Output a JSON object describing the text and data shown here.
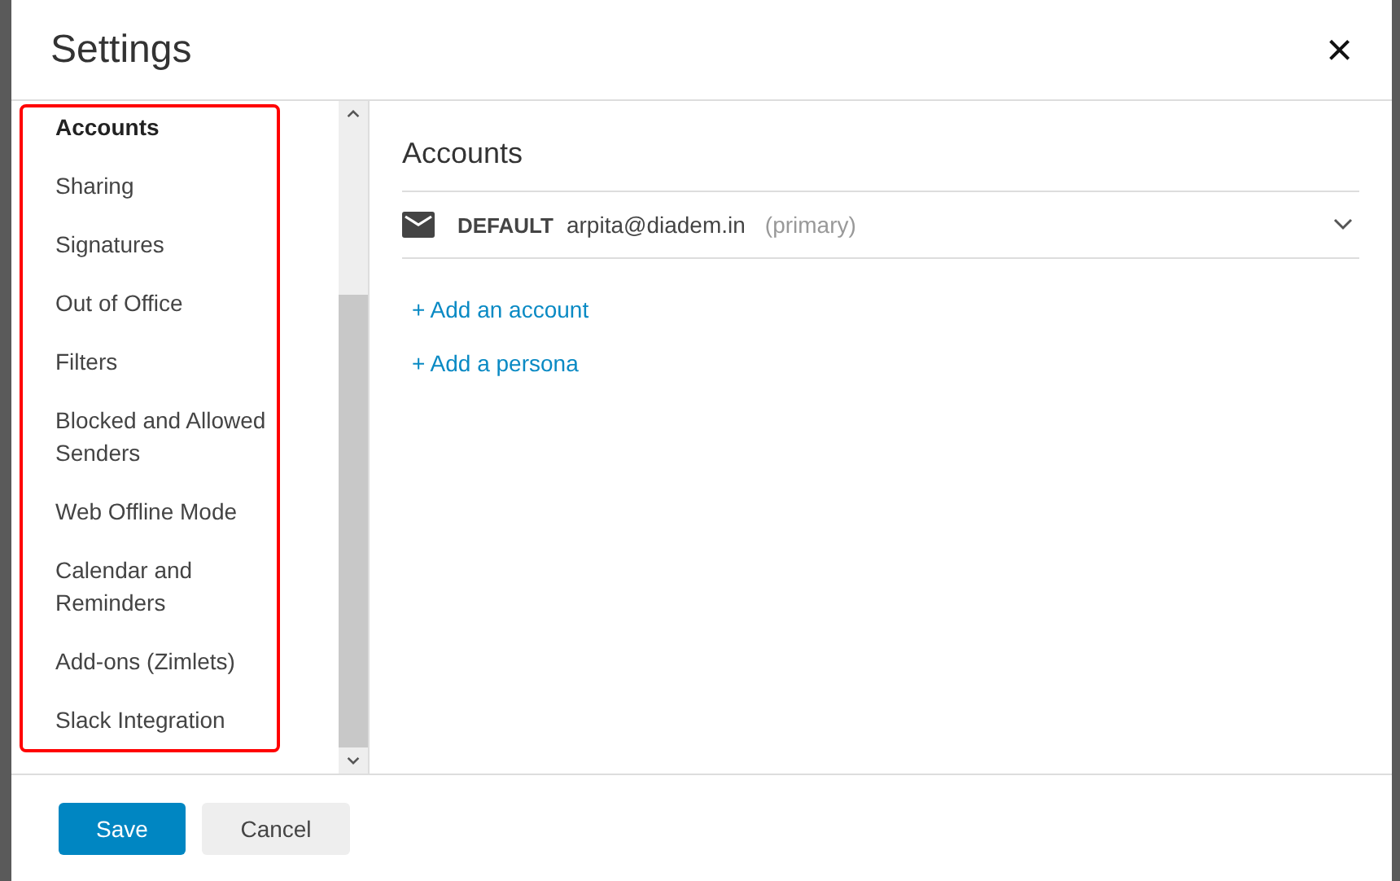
{
  "window": {
    "title": "Settings",
    "close": "×"
  },
  "sidebar": {
    "items": [
      {
        "label": "Accounts",
        "selected": true
      },
      {
        "label": "Sharing",
        "selected": false
      },
      {
        "label": "Signatures",
        "selected": false
      },
      {
        "label": "Out of Office",
        "selected": false
      },
      {
        "label": "Filters",
        "selected": false
      },
      {
        "label": "Blocked and Allowed Senders",
        "selected": false
      },
      {
        "label": "Web Offline Mode",
        "selected": false
      },
      {
        "label": "Calendar and Reminders",
        "selected": false
      },
      {
        "label": "Add-ons (Zimlets)",
        "selected": false
      },
      {
        "label": "Slack Integration",
        "selected": false
      }
    ]
  },
  "content": {
    "heading": "Accounts",
    "accounts": [
      {
        "tag": "DEFAULT",
        "email": "arpita@diadem.in",
        "note": "(primary)",
        "expanded": false
      }
    ],
    "links": [
      "+ Add an account",
      "+ Add a persona"
    ]
  },
  "buttons": [
    {
      "label": "Save",
      "kind": "primary"
    },
    {
      "label": "Cancel",
      "kind": "secondary"
    }
  ]
}
